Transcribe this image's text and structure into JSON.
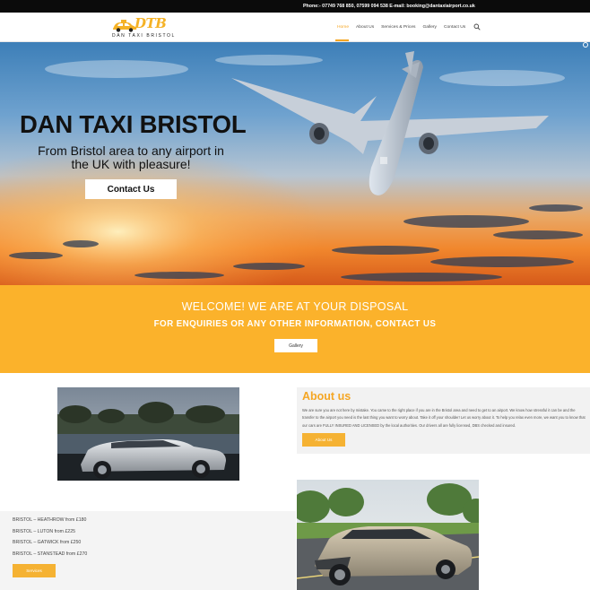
{
  "topbar": {
    "contact": "Phone:- 07749 768 850, 07599 094 538 E-mail:  booking@dantaxiairport.co.uk"
  },
  "logo": {
    "mark": "DTB",
    "text": "DAN TAXI BRISTOL"
  },
  "nav": {
    "items": [
      "Home",
      "About Us",
      "Services & Prices",
      "Gallery",
      "Contact Us"
    ],
    "search_icon": "search-icon"
  },
  "hero": {
    "title": "DAN TAXI BRISTOL",
    "subtitle": "From Bristol area to any airport in the UK with pleasure!",
    "button": "Contact Us"
  },
  "welcome": {
    "title": "WELCOME! WE ARE AT YOUR DISPOSAL",
    "subtitle": "FOR ENQUIRIES OR ANY OTHER INFORMATION, CONTACT US",
    "button": "Gallery"
  },
  "about": {
    "title": "About us",
    "text": "We are sure you are not here by mistake. You came to the right place if you are in the Bristol area and need to get to an airport. We know how stressful it can be and the transfer to the airport you need is the last thing you want to worry about. Take it off your shoulder! Let us worry about it. To help you relax even more, we want you to know that our cars are FULLY INSURED AND LICENSED by the local authorities. Our drivers all are fully licensed, DBS checked and insured.",
    "button": "About Us"
  },
  "prices": {
    "items": [
      "BRISTOL – HEATHROW from £180",
      "BRISTOL – LUTON from £225",
      "BRISTOL – GATWICK from £250",
      "BRISTOL – STANSTEAD from £270"
    ],
    "button": "Services"
  },
  "colors": {
    "accent": "#f5a623",
    "band": "#fbb22b",
    "topbar": "#0b0b0b"
  }
}
